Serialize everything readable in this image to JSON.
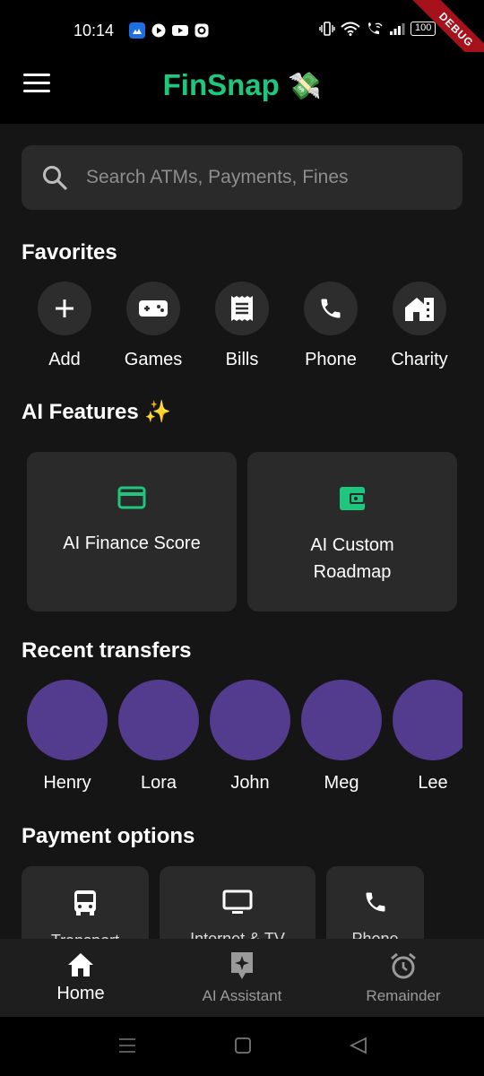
{
  "status_bar": {
    "time": "10:14",
    "battery": "100",
    "debug_banner": "DEBUG"
  },
  "app_bar": {
    "title": "FinSnap",
    "title_emoji": "💸",
    "accent_color": "#1fc77e"
  },
  "search": {
    "placeholder": "Search ATMs, Payments, Fines",
    "value": ""
  },
  "favorites": {
    "title": "Favorites",
    "items": [
      {
        "label": "Add",
        "icon": "plus-icon"
      },
      {
        "label": "Games",
        "icon": "gamepad-icon"
      },
      {
        "label": "Bills",
        "icon": "receipt-icon"
      },
      {
        "label": "Phone",
        "icon": "phone-icon"
      },
      {
        "label": "Charity",
        "icon": "house-icon"
      }
    ]
  },
  "ai_features": {
    "title": "AI Features",
    "title_emoji": "✨",
    "cards": [
      {
        "label": "AI Finance Score",
        "icon": "credit-card-icon"
      },
      {
        "label": "AI Custom Roadmap",
        "icon": "wallet-icon"
      }
    ]
  },
  "recent_transfers": {
    "title": "Recent transfers",
    "avatar_color": "#533b8e",
    "people": [
      {
        "name": "Henry"
      },
      {
        "name": "Lora"
      },
      {
        "name": "John"
      },
      {
        "name": "Meg"
      },
      {
        "name": "Lee"
      }
    ]
  },
  "payment_options": {
    "title": "Payment options",
    "items": [
      {
        "label": "Transport",
        "icon": "bus-icon"
      },
      {
        "label": "Internet & TV",
        "icon": "monitor-icon"
      },
      {
        "label": "Phone",
        "icon": "phone-icon"
      }
    ]
  },
  "bottom_nav": {
    "items": [
      {
        "label": "Home",
        "icon": "home-icon",
        "active": true
      },
      {
        "label": "AI Assistant",
        "icon": "ai-sparkle-icon",
        "active": false
      },
      {
        "label": "Remainder",
        "icon": "alarm-clock-icon",
        "active": false
      }
    ]
  }
}
